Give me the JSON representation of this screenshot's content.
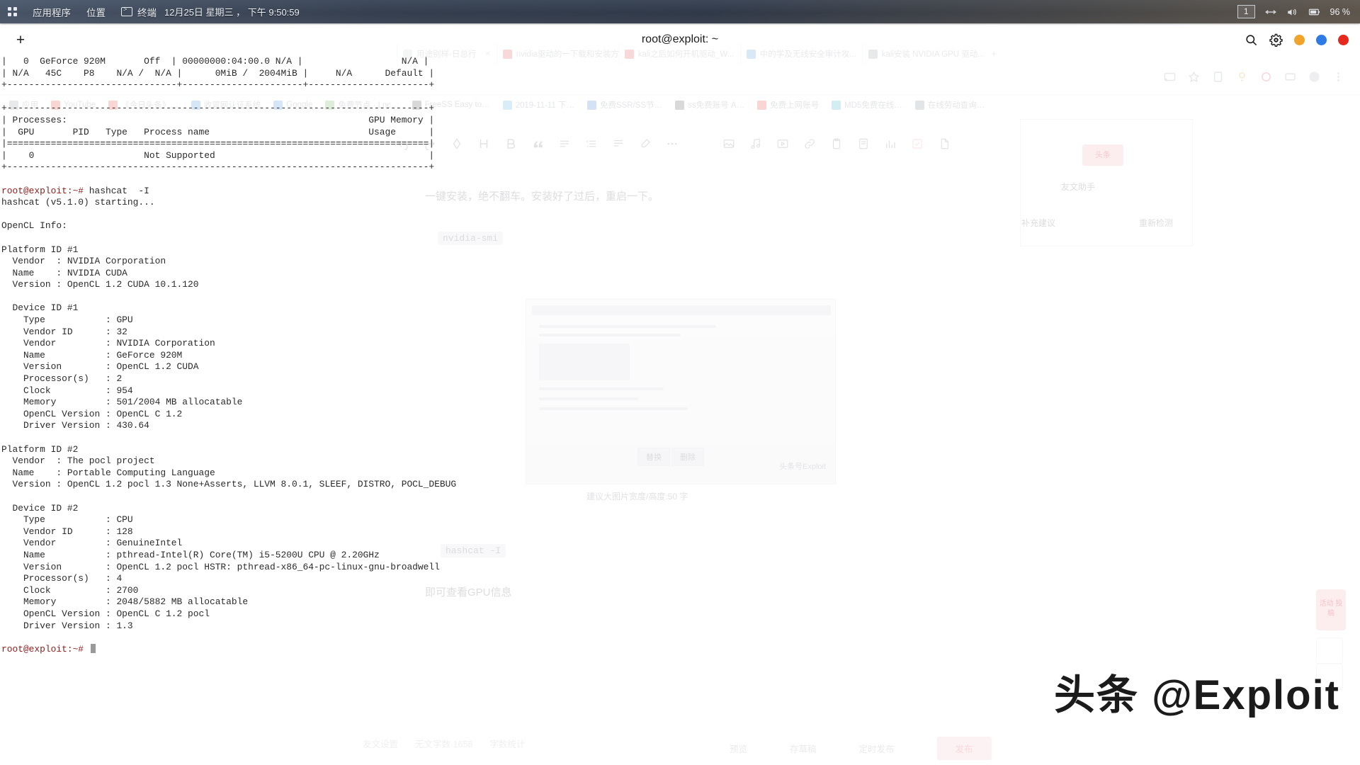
{
  "panel": {
    "activities_icon": "grid-icon",
    "applications_label": "应用程序",
    "places_label": "位置",
    "terminal_label": "终端",
    "terminal_icon": "terminal-icon",
    "clock": "12月25日 星期三 ， 下午 9:50:59",
    "workspace": "1",
    "network_icon": "network-icon",
    "volume_icon": "volume-icon",
    "battery_icon": "battery-icon",
    "battery_level": "96 %"
  },
  "terminal": {
    "title": "root@exploit: ~",
    "new_tab_label": "+",
    "search_icon": "search-icon",
    "menu_icon": "gear-icon",
    "minimize_label": "minimize",
    "maximize_label": "maximize",
    "close_label": "close",
    "lines": [
      "|   0  GeForce 920M       Off  | 00000000:04:00.0 N/A |                  N/A |",
      "| N/A   45C    P8    N/A /  N/A |      0MiB /  2004MiB |     N/A      Default |",
      "+-------------------------------+----------------------+----------------------+",
      "",
      "+-----------------------------------------------------------------------------+",
      "| Processes:                                                       GPU Memory |",
      "|  GPU       PID   Type   Process name                             Usage      |",
      "|=============================================================================|",
      "|    0                    Not Supported                                       |",
      "+-----------------------------------------------------------------------------+",
      "",
      "@PROMPT@ hashcat  -I",
      "hashcat (v5.1.0) starting...",
      "",
      "OpenCL Info:",
      "",
      "Platform ID #1",
      "  Vendor  : NVIDIA Corporation",
      "  Name    : NVIDIA CUDA",
      "  Version : OpenCL 1.2 CUDA 10.1.120",
      "",
      "  Device ID #1",
      "    Type           : GPU",
      "    Vendor ID      : 32",
      "    Vendor         : NVIDIA Corporation",
      "    Name           : GeForce 920M",
      "    Version        : OpenCL 1.2 CUDA",
      "    Processor(s)   : 2",
      "    Clock          : 954",
      "    Memory         : 501/2004 MB allocatable",
      "    OpenCL Version : OpenCL C 1.2",
      "    Driver Version : 430.64",
      "",
      "Platform ID #2",
      "  Vendor  : The pocl project",
      "  Name    : Portable Computing Language",
      "  Version : OpenCL 1.2 pocl 1.3 None+Asserts, LLVM 8.0.1, SLEEF, DISTRO, POCL_DEBUG",
      "",
      "  Device ID #2",
      "    Type           : CPU",
      "    Vendor ID      : 128",
      "    Vendor         : GenuineIntel",
      "    Name           : pthread-Intel(R) Core(TM) i5-5200U CPU @ 2.20GHz",
      "    Version        : OpenCL 1.2 pocl HSTR: pthread-x86_64-pc-linux-gnu-broadwell",
      "    Processor(s)   : 4",
      "    Clock          : 2700",
      "    Memory         : 2048/5882 MB allocatable",
      "    OpenCL Version : OpenCL C 1.2 pocl",
      "    Driver Version : 1.3",
      "",
      "@PROMPT@ @CURSOR@"
    ],
    "prompt": "root@exploit:~#"
  },
  "background": {
    "tabs": [
      {
        "title": "用途别样·日总行",
        "color": "#cfd4da"
      },
      {
        "title": "nvidia驱动的一下载和安装方法",
        "color": "#e0555a"
      },
      {
        "title": "kali之后如何开机驱动_W...",
        "color": "#e0555a"
      },
      {
        "title": "中的学及无线安全审计攻...",
        "color": "#5a9ad5"
      },
      {
        "title": "kali安装 NVIDIA GPU 驱动...",
        "color": "#9aa0a6"
      }
    ],
    "new_tab_label": "+",
    "bookmarks": [
      {
        "title": "应用",
        "color": "#9aa0a6"
      },
      {
        "title": "YouTube",
        "color": "#e8453c"
      },
      {
        "title": "《今日头条》…",
        "color": "#e8453c"
      },
      {
        "title": "收冒网认证系统",
        "color": "#4a90d9"
      },
      {
        "title": "Google",
        "color": "#4a90d9"
      },
      {
        "title": "免费节点 · Lnc…",
        "color": "#6db35b"
      },
      {
        "title": "FreeSS Easy to…",
        "color": "#555555"
      },
      {
        "title": "2019-11-11 下…",
        "color": "#58b0e5"
      },
      {
        "title": "免费SSR/SS节…",
        "color": "#3b7fd1"
      },
      {
        "title": "ss免费账号  A…",
        "color": "#555555"
      },
      {
        "title": "免费上网账号",
        "color": "#e8453c"
      },
      {
        "title": "MD5免费在线…",
        "color": "#3ab0c8"
      },
      {
        "title": "在线劳动查询…",
        "color": "#7b8b9a"
      }
    ],
    "toolbar_icons": [
      "undo-icon",
      "redo-icon",
      "format-clear-icon",
      "heading-icon",
      "bold-icon",
      "quote-icon",
      "unordered-list-icon",
      "ordered-list-icon",
      "align-icon",
      "highlight-icon",
      "more-icon",
      "image-icon",
      "music-icon",
      "video-icon",
      "link-icon",
      "clipboard-icon",
      "card-icon",
      "chart-icon",
      "vote-icon",
      "doc-icon"
    ],
    "body_paragraph": "一键安装，绝不翻车。安装好了过后，重启一下。",
    "code_nvidia": "nvidia-smi",
    "code_hashcat": "hashcat -I",
    "caption_gpu": "即可查看GPU信息",
    "image_caption": "建议大图片宽度/高度:50 字",
    "image_btn_replace": "替换",
    "image_btn_delete": "删除",
    "image_watermark": "头条号Exploit",
    "right_card_title": "友文助手",
    "right_card_action_left": "补充建议",
    "right_card_action_right": "重新检测",
    "pink_btn_label": "头条",
    "float_badge_label": "活动\n投稿",
    "bottom_left": [
      "友文设置",
      "无文字数  1658",
      "字数统计"
    ],
    "bottom_right": [
      "预览",
      "存草稿",
      "定时发布"
    ],
    "bottom_publish": "发布"
  },
  "watermark": "头条 @Exploit"
}
